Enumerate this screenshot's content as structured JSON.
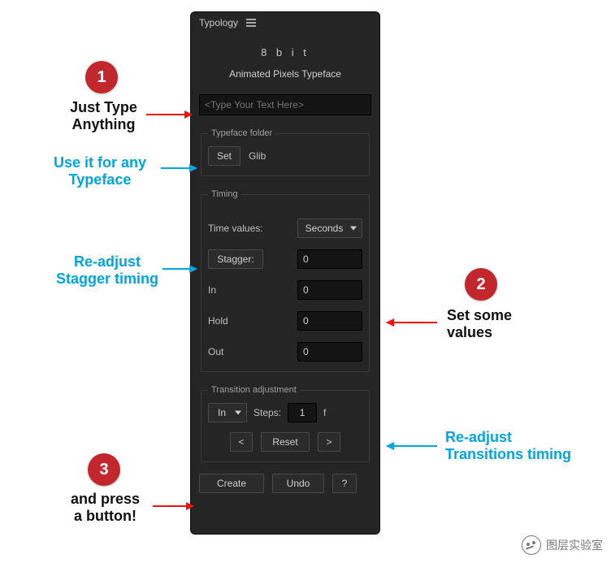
{
  "panel": {
    "name": "Typology",
    "title": "8 b i t",
    "subtitle": "Animated Pixels Typeface",
    "text_input_placeholder": "<Type Your Text Here>"
  },
  "typeface_folder": {
    "legend": "Typeface folder",
    "set_label": "Set",
    "folder_value": "Glib"
  },
  "timing": {
    "legend": "Timing",
    "time_values_label": "Time values:",
    "time_values_select": "Seconds",
    "stagger_label": "Stagger:",
    "stagger_value": "0",
    "in_label": "In",
    "in_value": "0",
    "hold_label": "Hold",
    "hold_value": "0",
    "out_label": "Out",
    "out_value": "0"
  },
  "transition": {
    "legend": "Transition adjustment",
    "dir_select": "In",
    "steps_label": "Steps:",
    "steps_value": "1",
    "suffix": "f",
    "prev": "<",
    "reset": "Reset",
    "next": ">"
  },
  "footer": {
    "create": "Create",
    "undo": "Undo",
    "help": "?"
  },
  "annotations": {
    "c1": "1",
    "c2": "2",
    "c3": "3",
    "a1": "Just Type\nAnything",
    "a2": "Use it for any\nTypeface",
    "a3": "Re-adjust\nStagger timing",
    "a4": "Set some\nvalues",
    "a5": "Re-adjust\nTransitions timing",
    "a6": "and press\na button!"
  },
  "watermark": "图层实验室"
}
